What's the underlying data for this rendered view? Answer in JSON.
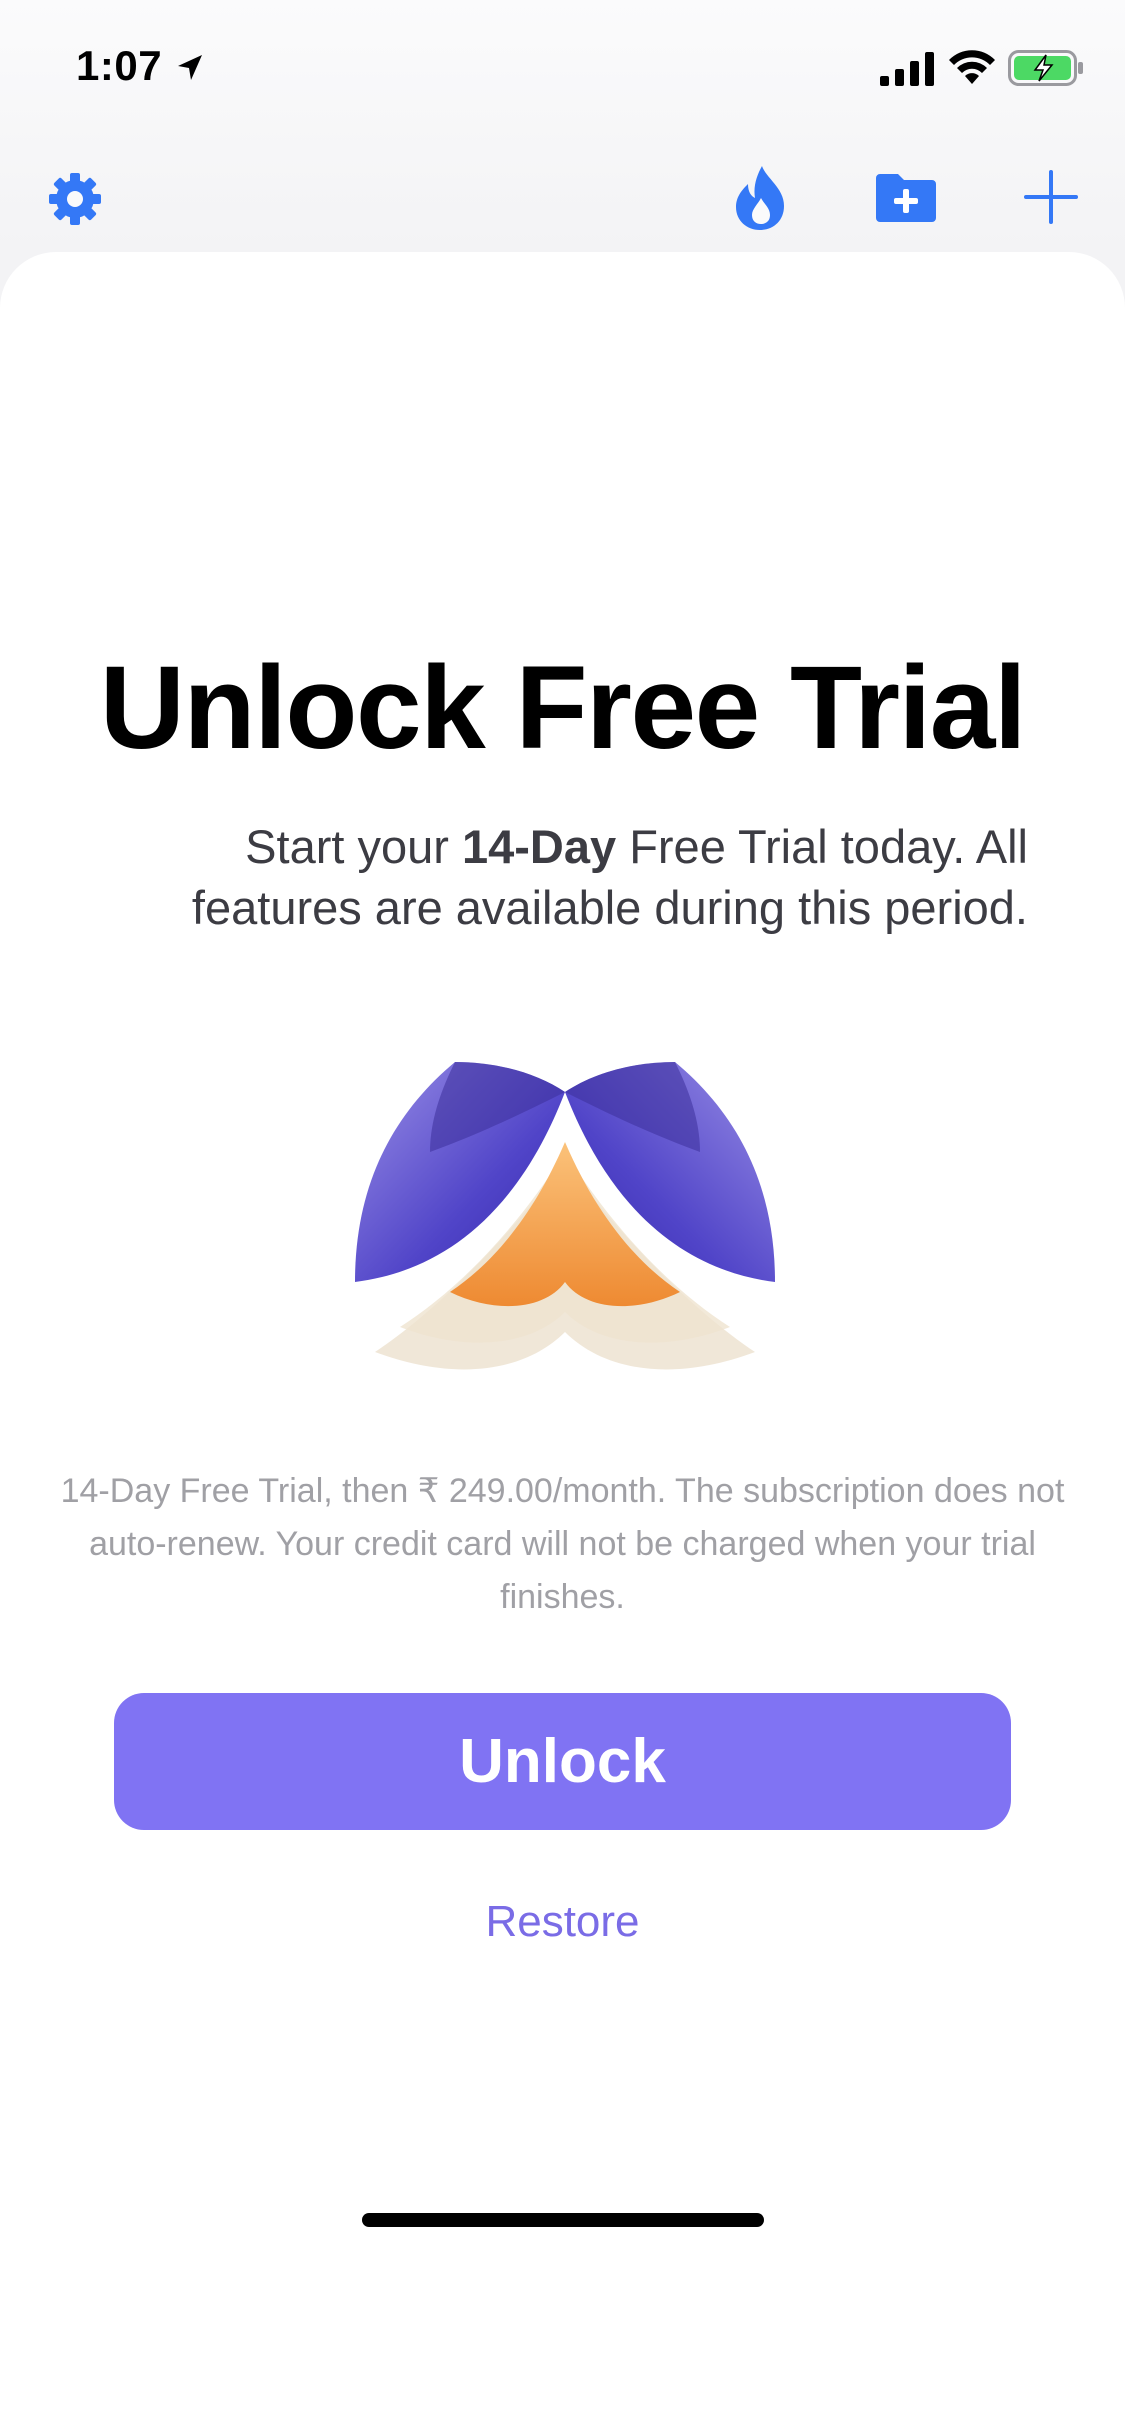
{
  "status_bar": {
    "time": "1:07"
  },
  "nav": {
    "icons": [
      "gear-icon",
      "flame-icon",
      "folder-add-icon",
      "plus-icon"
    ],
    "accent_color": "#3478f6"
  },
  "paywall": {
    "title": "Unlock Free Trial",
    "subtitle_prefix": "Start your ",
    "subtitle_bold": "14-Day",
    "subtitle_suffix": " Free Trial today. All features are available during this period.",
    "fine_print": "14-Day Free Trial, then ₹ 249.00/month. The subscription does not auto-renew. Your credit card will not be charged when your trial finishes.",
    "unlock_label": "Unlock",
    "restore_label": "Restore",
    "button_color": "#8073f3"
  }
}
